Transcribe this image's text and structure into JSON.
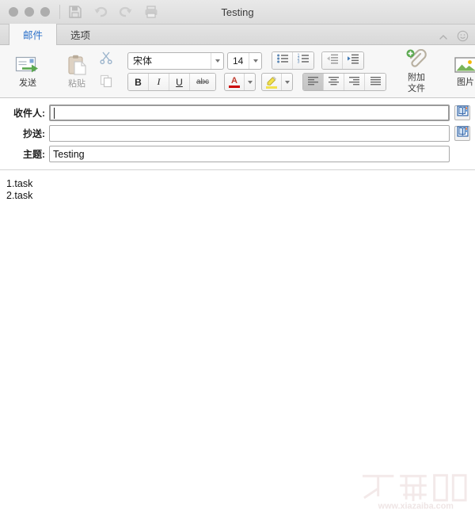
{
  "window": {
    "title": "Testing",
    "traffic_lights": [
      "close",
      "minimize",
      "maximize"
    ],
    "quick_access": [
      {
        "name": "save-icon",
        "label": "Save",
        "enabled": false
      },
      {
        "name": "undo-icon",
        "label": "Undo",
        "enabled": false
      },
      {
        "name": "redo-icon",
        "label": "Redo",
        "enabled": false
      },
      {
        "name": "print-icon",
        "label": "Print",
        "enabled": false
      }
    ]
  },
  "tabs": [
    {
      "label": "邮件",
      "active": true
    },
    {
      "label": "选项",
      "active": false
    }
  ],
  "tab_controls": {
    "collapse_icon": "chevron-up-icon",
    "help_icon": "smiley-icon"
  },
  "ribbon": {
    "send": {
      "label": "发送",
      "icon": "send-mail-icon"
    },
    "clipboard": {
      "paste": {
        "label": "粘贴",
        "icon": "paste-icon",
        "enabled": false
      },
      "cut": {
        "label": "剪切",
        "icon": "scissors-icon",
        "enabled": false
      },
      "copy": {
        "label": "复制",
        "icon": "copy-icon",
        "enabled": false
      }
    },
    "font": {
      "family": "宋体",
      "size": "14",
      "bold": "B",
      "italic": "I",
      "underline": "U",
      "strikethrough": "abc",
      "font_color": {
        "glyph": "A",
        "color": "#cc0000"
      },
      "highlight_color": {
        "icon": "highlighter-icon",
        "color": "#f2e14c"
      }
    },
    "paragraph": {
      "bullet_list": "bullet-list-icon",
      "numbered_list": "numbered-list-icon",
      "outdent": "outdent-icon",
      "indent": "indent-icon",
      "align_left": {
        "icon": "align-left-icon",
        "active": true
      },
      "align_center": {
        "icon": "align-center-icon",
        "active": false
      },
      "align_right": {
        "icon": "align-right-icon",
        "active": false
      },
      "align_justify": {
        "icon": "align-justify-icon",
        "active": false
      }
    },
    "attach": {
      "label_line1": "附加",
      "label_line2": "文件",
      "icon": "paperclip-plus-icon"
    },
    "insert": {
      "picture": {
        "label": "图片",
        "icon": "picture-icon"
      },
      "signature": {
        "icon": "signature-pen-icon"
      },
      "hyperlink": {
        "icon": "globe-link-icon"
      }
    }
  },
  "fields": {
    "to": {
      "label": "收件人:",
      "value": "",
      "placeholder": "",
      "focused": true,
      "address_book": "address-book-icon"
    },
    "cc": {
      "label": "抄送:",
      "value": "",
      "placeholder": "",
      "focused": false,
      "address_book": "address-book-icon"
    },
    "subject": {
      "label": "主题:",
      "value": "Testing",
      "placeholder": ""
    }
  },
  "body": {
    "lines": [
      "1.task",
      "2.task"
    ]
  },
  "watermark": {
    "text": "下载吧",
    "url": "www.xiazaiba.com"
  },
  "colors": {
    "accent": "#2b70c9",
    "titlebar": "#e3e3e3",
    "ribbon_bg": "#f7f7f7",
    "font_color_swatch": "#cc0000",
    "highlight_swatch": "#f2e14c",
    "send_arrow": "#5aa84f"
  }
}
